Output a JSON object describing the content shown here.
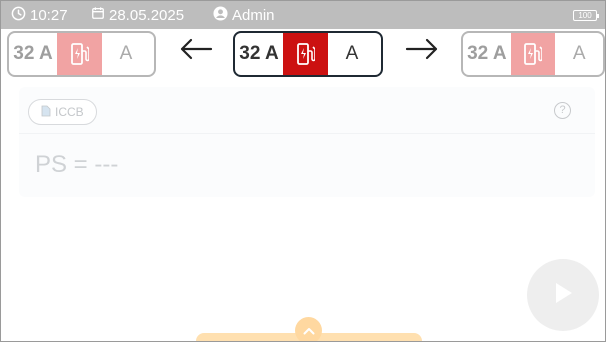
{
  "status_bar": {
    "time": "10:27",
    "date": "28.05.2025",
    "user": "Admin",
    "battery": "100",
    "icons": {
      "time": "clock-icon",
      "date": "calendar-icon",
      "user": "user-icon",
      "battery": "battery-icon"
    }
  },
  "toggles": {
    "left": {
      "current": "32 A",
      "unit": "A",
      "icon": "ev-charger-icon"
    },
    "center": {
      "current": "32 A",
      "unit": "A",
      "icon": "ev-charger-icon"
    },
    "right": {
      "current": "32 A",
      "unit": "A",
      "icon": "ev-charger-icon"
    }
  },
  "nav": {
    "prev_icon": "arrow-left-icon",
    "next_icon": "arrow-right-icon"
  },
  "card": {
    "chip_label": "ICCB",
    "chip_icon": "document-icon",
    "help_icon": "help-circle-icon",
    "ps_text": "PS = ---"
  },
  "actions": {
    "play_icon": "play-icon",
    "expand_icon": "chevron-up-icon"
  },
  "colors": {
    "status_bar": "#bdbdbd",
    "accent_red": "#cc1111",
    "accent_red_muted": "#f1a3a3",
    "dark_border": "#1f2933",
    "bottom_handle": "#ffd8a0"
  }
}
